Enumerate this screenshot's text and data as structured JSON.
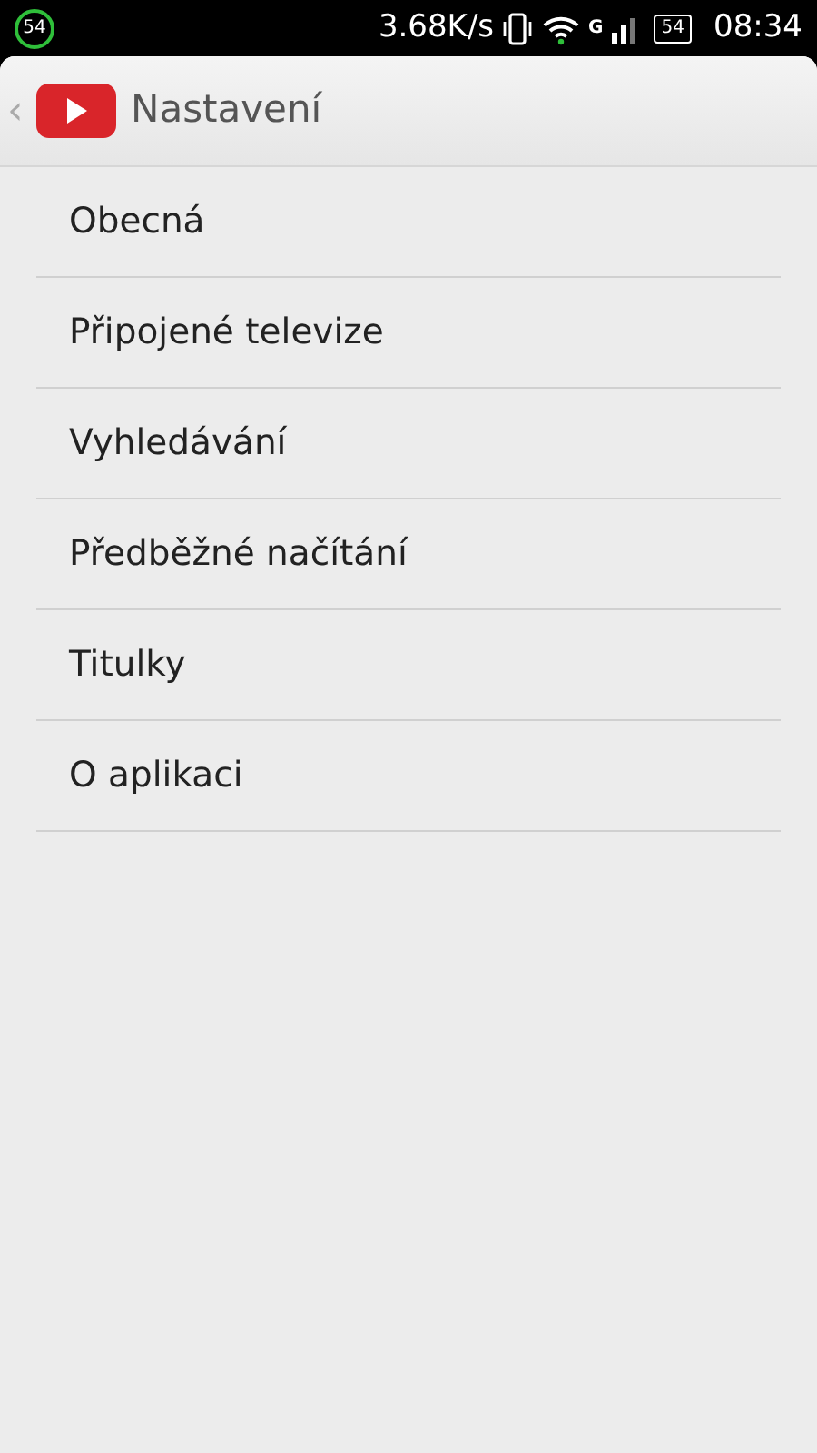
{
  "status_bar": {
    "badge": "54",
    "speed": "3.68K/s",
    "network_type": "G",
    "battery": "54",
    "time": "08:34"
  },
  "action_bar": {
    "back": "‹",
    "title": "Nastavení"
  },
  "items": [
    {
      "label": "Obecná"
    },
    {
      "label": "Připojené televize"
    },
    {
      "label": "Vyhledávání"
    },
    {
      "label": "Předběžné načítání"
    },
    {
      "label": "Titulky"
    },
    {
      "label": "O aplikaci"
    }
  ]
}
